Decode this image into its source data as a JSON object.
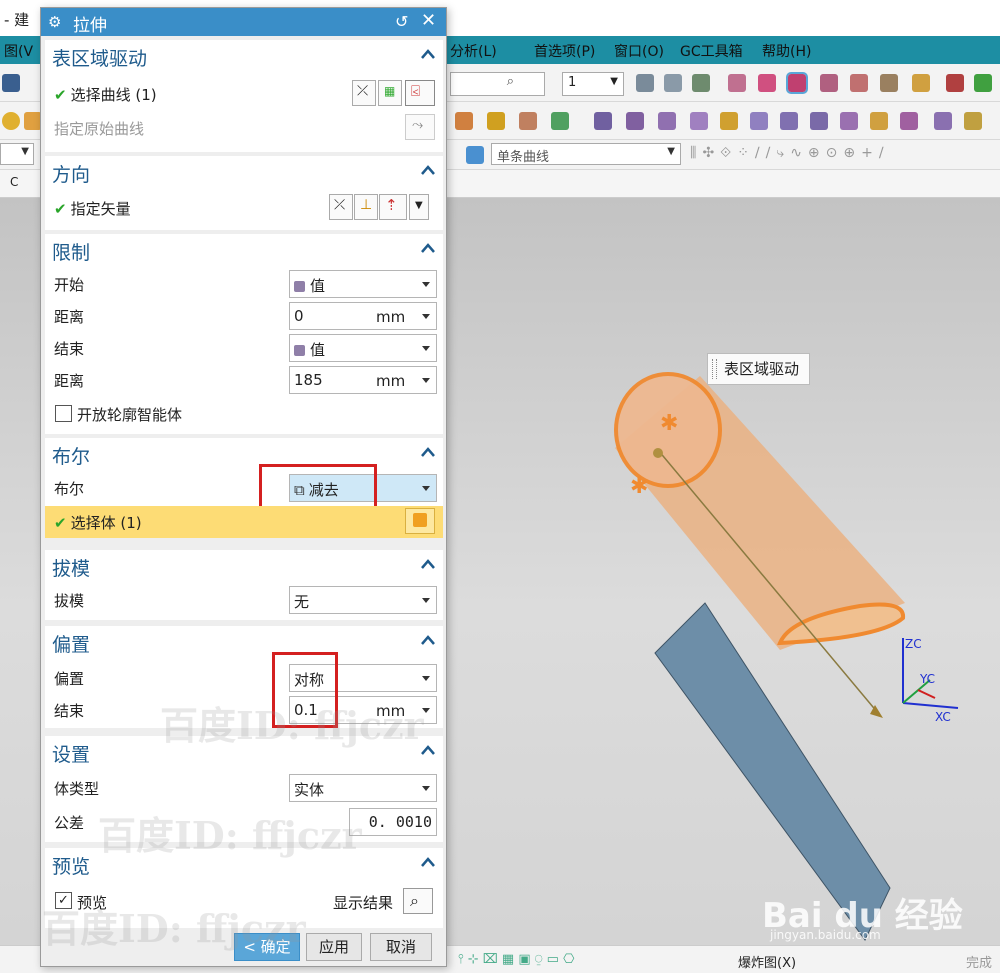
{
  "app": {
    "title_fragment": "- 建",
    "menu_items": [
      "图(V",
      "分析(L)",
      "首选项(P)",
      "窗口(O)",
      "GC工具箱",
      "帮助(H)"
    ],
    "toolbar": {
      "number_field": "1",
      "curve_filter": "单条曲线"
    },
    "bottom_bar": {
      "exploded_view": "爆炸图(X)",
      "finish": "完成"
    }
  },
  "dialog": {
    "title": "拉伸",
    "sections": {
      "section_curve": {
        "title": "表区域驱动",
        "select_curve": "选择曲线 (1)",
        "specify_original": "指定原始曲线"
      },
      "direction": {
        "title": "方向",
        "specify_vector": "指定矢量"
      },
      "limits": {
        "title": "限制",
        "start_label": "开始",
        "start_value": "值",
        "start_dist_label": "距离",
        "start_dist_value": "0",
        "start_dist_unit": "mm",
        "end_label": "结束",
        "end_value": "值",
        "end_dist_label": "距离",
        "end_dist_value": "185",
        "end_dist_unit": "mm",
        "open_profile": "开放轮廓智能体"
      },
      "boolean": {
        "title": "布尔",
        "label": "布尔",
        "value": "减去",
        "select_body": "选择体 (1)"
      },
      "draft": {
        "title": "拔模",
        "label": "拔模",
        "value": "无"
      },
      "offset": {
        "title": "偏置",
        "label": "偏置",
        "value": "对称",
        "end_label": "结束",
        "end_value": "0.1",
        "end_unit": "mm"
      },
      "settings": {
        "title": "设置",
        "body_type_label": "体类型",
        "body_type_value": "实体",
        "tolerance_label": "公差",
        "tolerance_value": "0. 0010"
      },
      "preview": {
        "title": "预览",
        "preview_label": "预览",
        "preview_checked": true,
        "show_result": "显示结果"
      }
    },
    "buttons": {
      "ok": "< 确定 >",
      "apply": "应用",
      "cancel": "取消"
    }
  },
  "viewport": {
    "tooltip": "表区域驱动",
    "axis_labels": {
      "zc": "ZC",
      "yc": "YC",
      "xc": "XC"
    }
  },
  "watermarks": [
    "百度ID: ffjczr",
    "百度ID: ffjczr",
    "百度ID: ffjczr"
  ],
  "baidu": {
    "logo": "Bai du 经验",
    "url": "jingyan.baidu.com"
  },
  "colors": {
    "accent": "#3a8ec8",
    "menubar": "#1d8ea3",
    "section_title": "#1f5b8c",
    "highlight_row": "#fddc75",
    "annotation_red": "#d42020",
    "cylinder": "#e8a060"
  }
}
